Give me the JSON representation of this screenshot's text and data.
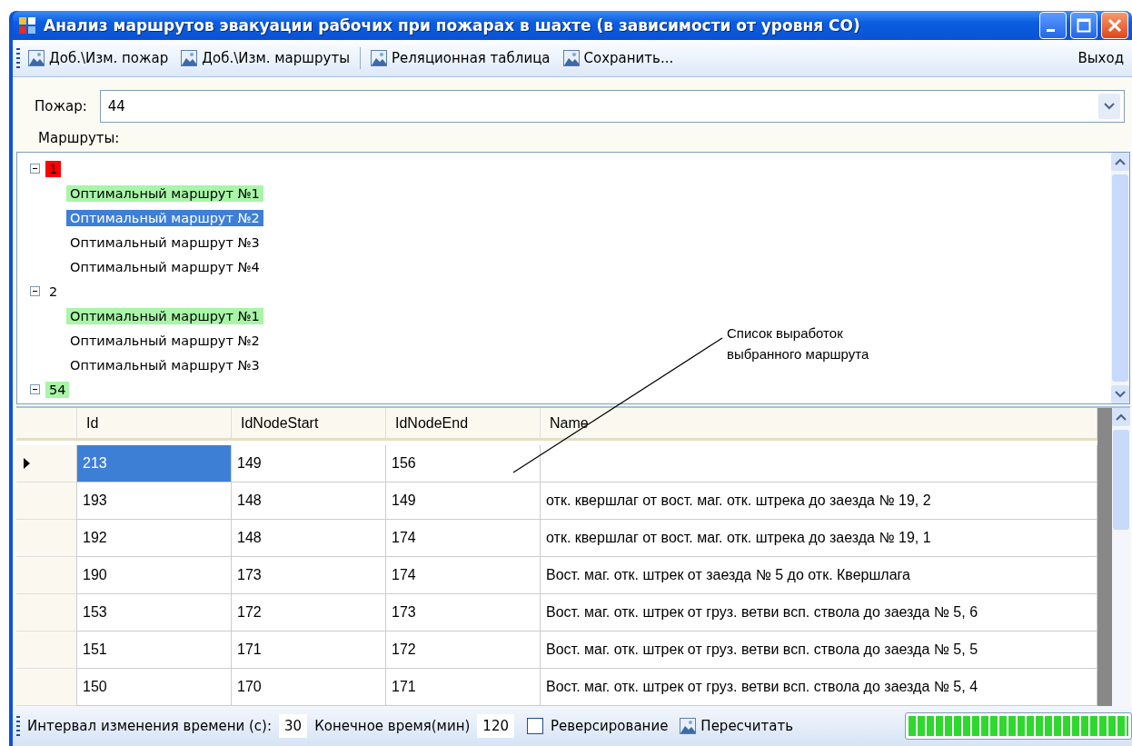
{
  "window": {
    "title": "Анализ маршрутов эвакуации рабочих при пожарах в шахте (в зависимости от уровня СО)"
  },
  "toolbar": {
    "items": [
      {
        "kind": "button",
        "label": "Доб.\\Изм. пожар"
      },
      {
        "kind": "button",
        "label": "Доб.\\Изм. маршруты"
      },
      {
        "kind": "separator"
      },
      {
        "kind": "button",
        "label": "Реляционная таблица"
      },
      {
        "kind": "button",
        "label": "Сохранить..."
      }
    ],
    "exit": "Выход"
  },
  "fire": {
    "label": "Пожар:",
    "value": "44"
  },
  "routes": {
    "label": "Маршруты:",
    "tree": [
      {
        "label": "1",
        "expanded": true,
        "color": "#ff0000",
        "children": [
          {
            "label": "Оптимальный маршрут №1",
            "color": "#a8f5a8",
            "selected": false
          },
          {
            "label": "Оптимальный маршрут №2",
            "selected": true
          },
          {
            "label": "Оптимальный маршрут №3",
            "selected": false
          },
          {
            "label": "Оптимальный маршрут №4",
            "selected": false
          }
        ]
      },
      {
        "label": "2",
        "expanded": true,
        "children": [
          {
            "label": "Оптимальный маршрут №1",
            "color": "#a8f5a8",
            "selected": false
          },
          {
            "label": "Оптимальный маршрут №2",
            "selected": false
          },
          {
            "label": "Оптимальный маршрут №3",
            "selected": false
          }
        ]
      },
      {
        "label": "54",
        "expanded": true,
        "color": "#a8f5a8"
      }
    ]
  },
  "annotation": "Список выработок выбранного маршрута",
  "table": {
    "columns": [
      "Id",
      "IdNodeStart",
      "IdNodeEnd",
      "Name"
    ],
    "rows": [
      {
        "selected": true,
        "cells": [
          "213",
          "149",
          "156",
          ""
        ]
      },
      {
        "selected": false,
        "cells": [
          "193",
          "148",
          "149",
          "отк. квершлаг от вост. маг. отк. штрека до заезда № 19, 2"
        ]
      },
      {
        "selected": false,
        "cells": [
          "192",
          "148",
          "174",
          "отк. квершлаг от вост. маг. отк. штрека до заезда № 19, 1"
        ]
      },
      {
        "selected": false,
        "cells": [
          "190",
          "173",
          "174",
          "Вост. маг. отк. штрек от заезда № 5 до отк. Квершлага"
        ]
      },
      {
        "selected": false,
        "cells": [
          "153",
          "172",
          "173",
          "Вост. маг. отк. штрек от груз. ветви всп. ствола до заезда № 5, 6"
        ]
      },
      {
        "selected": false,
        "cells": [
          "151",
          "171",
          "172",
          "Вост. маг. отк. штрек от груз. ветви всп. ствола до заезда № 5, 5"
        ]
      },
      {
        "selected": false,
        "cells": [
          "150",
          "170",
          "171",
          "Вост. маг. отк. штрек от груз. ветви всп. ствола до заезда № 5, 4"
        ]
      }
    ]
  },
  "status_bar": {
    "interval_label": "Интервал изменения времени (с):",
    "interval_value": "30",
    "end_label": "Конечное время(мин)",
    "end_value": "120",
    "reverse": {
      "label": "Реверсирование",
      "checked": false
    },
    "recalc": "Пересчитать",
    "progress": {
      "level": 1
    }
  }
}
